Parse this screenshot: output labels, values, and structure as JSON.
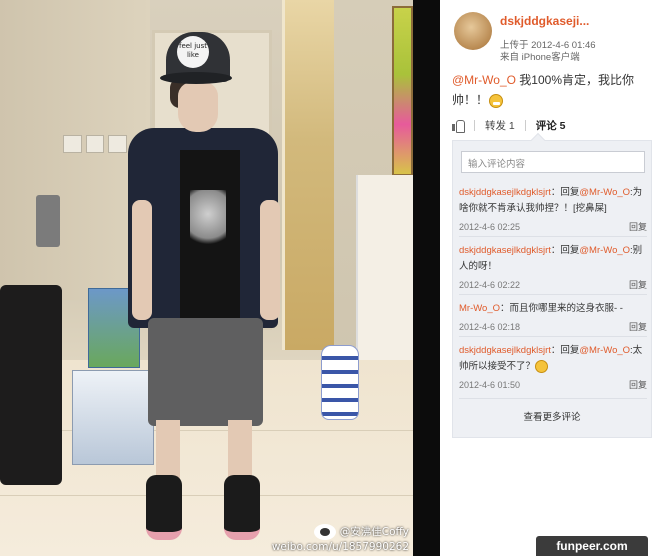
{
  "photo": {
    "hat_text": "feel just like",
    "watermark_handle": "@安沸佳Coffy",
    "watermark_url": "weibo.com/u/1857990262"
  },
  "post": {
    "username": "dskjddgkaseji...",
    "time": "上传于 2012-4-6 01:46",
    "source": "来自 iPhone客户端",
    "body_mention": "@Mr-Wo_O",
    "body_text": " 我100%肯定，我比你帅！！",
    "actions": {
      "repost_label": "转发 1",
      "comment_label": "评论 5"
    }
  },
  "comments": {
    "input_placeholder": "输入评论内容",
    "items": [
      {
        "author": "dskjddgkasejlkdgklsjrt",
        "reply_prefix": "：回复",
        "mention": "@Mr-Wo_O",
        "text": ":为啥你就不肯承认我帅捏？！[挖鼻屎]",
        "time": "2012-4-6 02:25",
        "reply": "回复"
      },
      {
        "author": "dskjddgkasejlkdgklsjrt",
        "reply_prefix": "：回复",
        "mention": "@Mr-Wo_O",
        "text": ":别人的呀！",
        "time": "2012-4-6 02:22",
        "reply": "回复"
      },
      {
        "author": "Mr-Wo_O",
        "reply_prefix": "",
        "mention": "",
        "text": "：而且你哪里来的这身衣服- -",
        "time": "2012-4-6 02:18",
        "reply": "回复"
      },
      {
        "author": "dskjddgkasejlkdgklsjrt",
        "reply_prefix": "：回复",
        "mention": "@Mr-Wo_O",
        "text": ":太帅所以接受不了？",
        "time": "2012-4-6 01:50",
        "reply": "回复"
      }
    ],
    "more_label": "查看更多评论"
  },
  "site_badge": "funpeer.com",
  "colors": {
    "link_orange": "#e05b2b",
    "comment_bg": "#eef0f4",
    "divider": "#0c0c0c"
  }
}
